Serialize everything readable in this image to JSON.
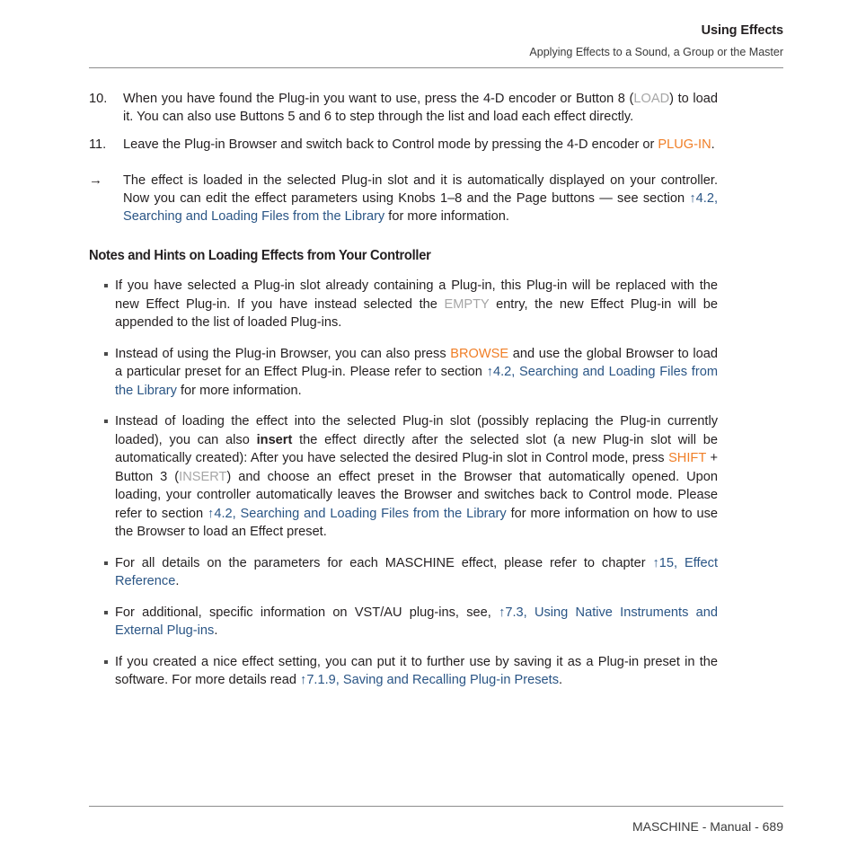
{
  "header": {
    "title": "Using Effects",
    "subtitle": "Applying Effects to a Sound, a Group or the Master"
  },
  "steps": [
    {
      "marker": "10.",
      "parts": [
        {
          "text": "When you have found the Plug-in you want to use, press the 4-D encoder or Button 8 (",
          "style": "normal"
        },
        {
          "text": "LOAD",
          "style": "gray"
        },
        {
          "text": ") to load it. You can also use Buttons 5 and 6 to step through the list and load each effect directly.",
          "style": "normal"
        }
      ]
    },
    {
      "marker": "11.",
      "parts": [
        {
          "text": "Leave the Plug-in Browser and switch back to Control mode by pressing the 4-D encoder or ",
          "style": "normal"
        },
        {
          "text": "PLUG-IN",
          "style": "hardware"
        },
        {
          "text": ".",
          "style": "normal"
        }
      ]
    },
    {
      "marker": "→",
      "parts": [
        {
          "text": "The effect is loaded in the selected Plug-in slot and it is automatically displayed on your controller. Now you can edit the effect parameters using Knobs 1–8 and the Page buttons — see section ",
          "style": "normal"
        },
        {
          "text": "↑4.2, Searching and Loading Files from the Library",
          "style": "link"
        },
        {
          "text": " for more information.",
          "style": "normal"
        }
      ]
    }
  ],
  "section_heading": "Notes and Hints on Loading Effects from Your Controller",
  "bullets": [
    {
      "parts": [
        {
          "text": "If you have selected a Plug-in slot already containing a Plug-in, this Plug-in will be replaced with the new Effect Plug-in. If you have instead selected the ",
          "style": "normal"
        },
        {
          "text": "EMPTY",
          "style": "gray"
        },
        {
          "text": " entry, the new Effect Plug-in will be appended to the list of loaded Plug-ins.",
          "style": "normal"
        }
      ]
    },
    {
      "parts": [
        {
          "text": "Instead of using the Plug-in Browser, you can also press ",
          "style": "normal"
        },
        {
          "text": "BROWSE",
          "style": "hardware"
        },
        {
          "text": " and use the global Browser to load a particular preset for an Effect Plug-in. Please refer to section ",
          "style": "normal"
        },
        {
          "text": "↑4.2, Searching and Loading Files from the Library",
          "style": "link"
        },
        {
          "text": " for more information.",
          "style": "normal"
        }
      ]
    },
    {
      "parts": [
        {
          "text": "Instead of loading the effect into the selected Plug-in slot (possibly replacing the Plug-in currently loaded), you can also ",
          "style": "normal"
        },
        {
          "text": "insert",
          "style": "bold"
        },
        {
          "text": " the effect directly after the selected slot (a new Plug-in slot will be automatically created): After you have selected the desired Plug-in slot in Control mode, press ",
          "style": "normal"
        },
        {
          "text": "SHIFT",
          "style": "hardware"
        },
        {
          "text": " + Button 3 (",
          "style": "normal"
        },
        {
          "text": "INSERT",
          "style": "gray"
        },
        {
          "text": ") and choose an effect preset in the Browser that automatically opened. Upon loading, your controller automatically leaves the Browser and switches back to Control mode. Please refer to section ",
          "style": "normal"
        },
        {
          "text": "↑4.2, Searching and Loading Files from the Library",
          "style": "link"
        },
        {
          "text": " for more information on how to use the Browser to load an Effect preset.",
          "style": "normal"
        }
      ]
    },
    {
      "parts": [
        {
          "text": "For all details on the parameters for each MASCHINE effect, please refer to chapter ",
          "style": "normal"
        },
        {
          "text": "↑15, Effect Reference",
          "style": "link"
        },
        {
          "text": ".",
          "style": "normal"
        }
      ]
    },
    {
      "parts": [
        {
          "text": "For additional, specific information on VST/AU plug-ins, see, ",
          "style": "normal"
        },
        {
          "text": "↑7.3, Using Native Instruments and External Plug-ins",
          "style": "link"
        },
        {
          "text": ".",
          "style": "normal"
        }
      ]
    },
    {
      "parts": [
        {
          "text": "If you created a nice effect setting, you can put it to further use by saving it as a Plug-in preset in the software. For more details read ",
          "style": "normal"
        },
        {
          "text": "↑7.1.9, Saving and Recalling Plug-in Presets",
          "style": "link"
        },
        {
          "text": ".",
          "style": "normal"
        }
      ]
    }
  ],
  "footer": {
    "text": "MASCHINE - Manual - 689"
  },
  "colors": {
    "link": "#2a5585",
    "hardware": "#f07e26",
    "gray": "#a6a6a6",
    "text": "#231f20",
    "rule": "#8d8d8d"
  }
}
